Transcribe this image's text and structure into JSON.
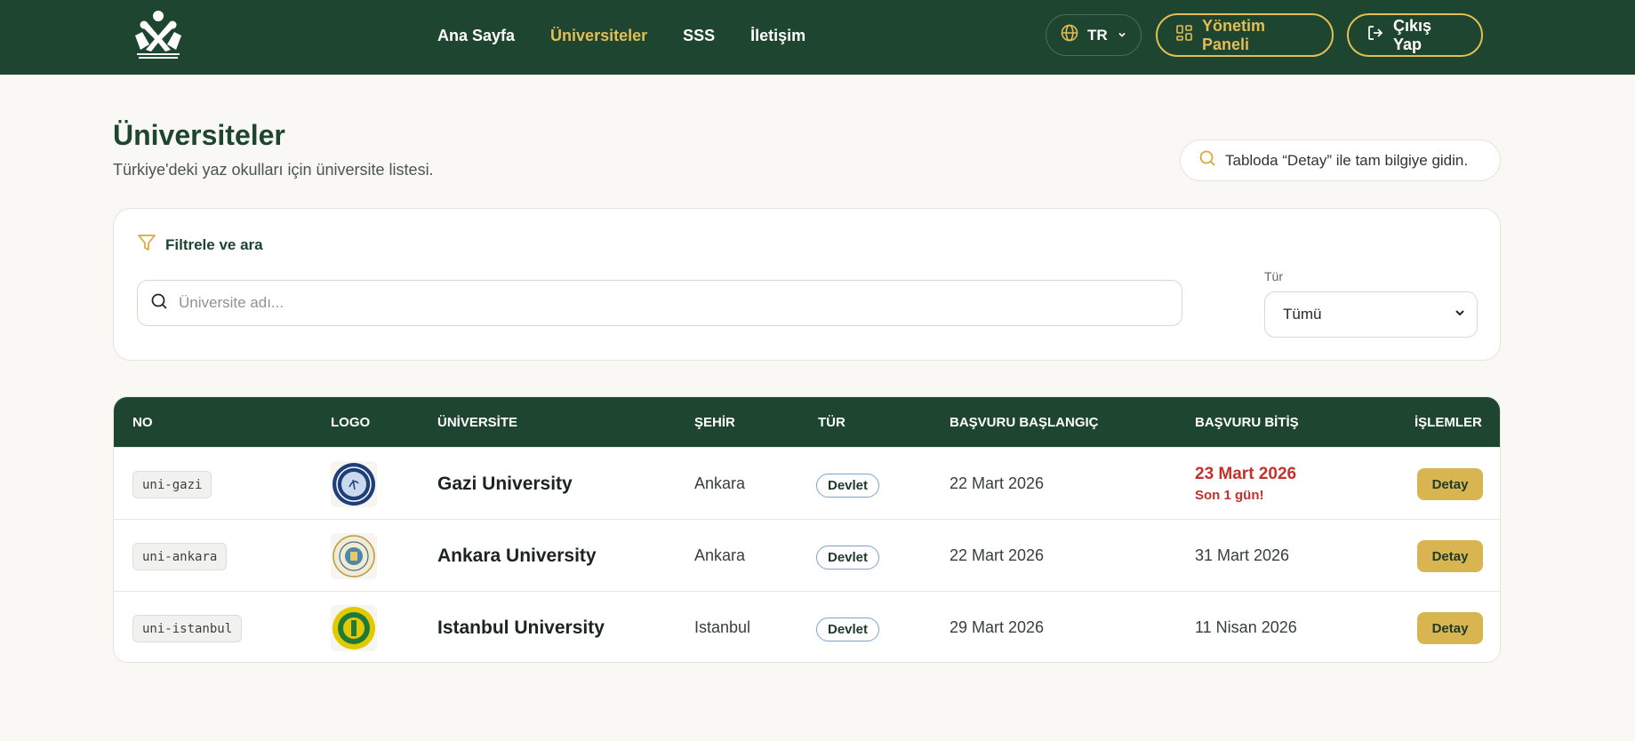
{
  "header": {
    "nav": [
      "Ana Sayfa",
      "Üniversiteler",
      "SSS",
      "İletişim"
    ],
    "lang": "TR",
    "admin_label": "Yönetim Paneli",
    "logout_label": "Çıkış Yap",
    "colors": {
      "bg": "#1e4530",
      "accent": "#e3bd55"
    }
  },
  "page": {
    "title": "Üniversiteler",
    "subtitle": "Türkiye'deki yaz okulları için üniversite listesi.",
    "hint": "Tabloda “Detay” ile tam bilgiye gidin."
  },
  "filter": {
    "title": "Filtrele ve ara",
    "search_placeholder": "Üniversite adı...",
    "type_label": "Tür",
    "type_value": "Tümü"
  },
  "table": {
    "headers": [
      "NO",
      "LOGO",
      "ÜNİVERSİTE",
      "ŞEHİR",
      "TÜR",
      "BAŞVURU BAŞLANGIÇ",
      "BAŞVURU BİTİŞ",
      "İŞLEMLER"
    ],
    "rows": [
      {
        "code": "uni-gazi",
        "name": "Gazi University",
        "city": "Ankara",
        "type": "Devlet",
        "start": "22 Mart 2026",
        "end": "23 Mart 2026",
        "warning": "Son 1 gün!",
        "action": "Detay"
      },
      {
        "code": "uni-ankara",
        "name": "Ankara University",
        "city": "Ankara",
        "type": "Devlet",
        "start": "22 Mart 2026",
        "end": "31 Mart 2026",
        "action": "Detay"
      },
      {
        "code": "uni-istanbul",
        "name": "Istanbul University",
        "city": "Istanbul",
        "type": "Devlet",
        "start": "29 Mart 2026",
        "end": "11 Nisan 2026",
        "action": "Detay"
      }
    ]
  }
}
